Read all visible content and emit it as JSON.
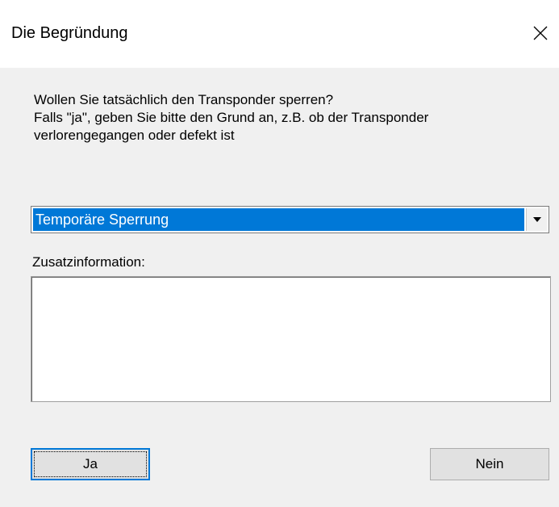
{
  "window": {
    "title": "Die Begründung",
    "close_icon": "close-icon"
  },
  "message": {
    "line1": "Wollen Sie tatsächlich  den Transponder sperren?",
    "line2": "Falls \"ja\", geben Sie bitte den Grund an, z.B. ob der Transponder",
    "line3": "verlorengegangen oder defekt ist"
  },
  "reason_select": {
    "selected_value": "Temporäre Sperrung",
    "arrow_icon": "dropdown-arrow-icon"
  },
  "additional_info": {
    "label": "Zusatzinformation:",
    "value": ""
  },
  "buttons": {
    "yes_label": "Ja",
    "no_label": "Nein"
  },
  "colors": {
    "selection": "#0078d7",
    "dialog_background": "#f0f0f0",
    "titlebar_background": "#ffffff",
    "button_face": "#e1e1e1"
  }
}
